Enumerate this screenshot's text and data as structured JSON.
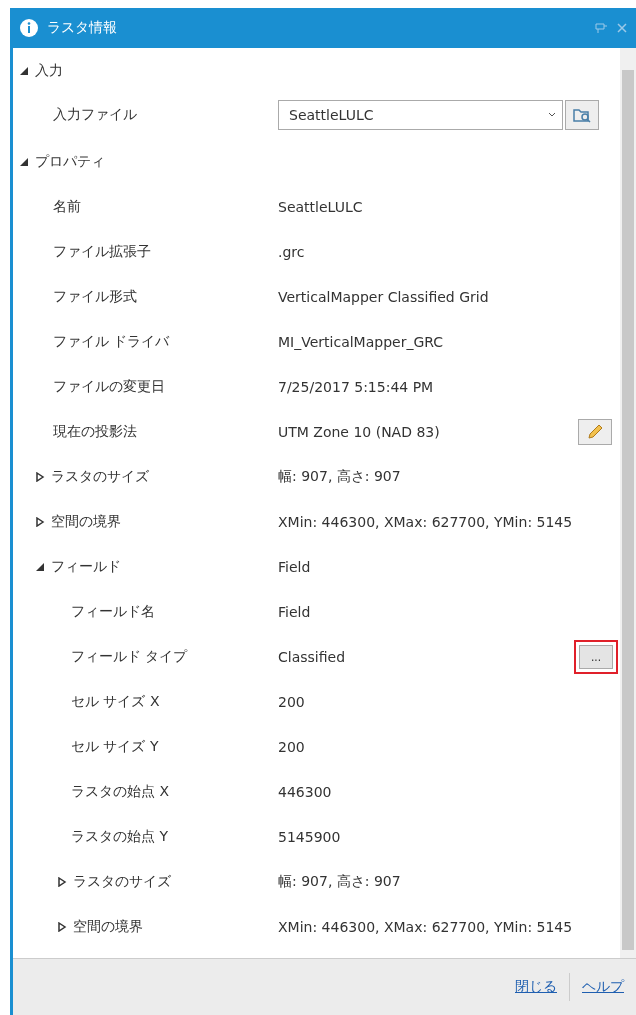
{
  "window": {
    "title": "ラスタ情報"
  },
  "sections": [
    {
      "label": "入力",
      "expanded": true,
      "children": [
        {
          "kind": "dropdown",
          "label": "入力ファイル",
          "value": "SeattleLULC"
        }
      ]
    },
    {
      "label": "プロパティ",
      "expanded": true,
      "children": [
        {
          "kind": "text",
          "label": "名前",
          "value": "SeattleLULC"
        },
        {
          "kind": "text",
          "label": "ファイル拡張子",
          "value": ".grc"
        },
        {
          "kind": "text",
          "label": "ファイル形式",
          "value": "VerticalMapper Classified Grid"
        },
        {
          "kind": "text",
          "label": "ファイル ドライバ",
          "value": "MI_VerticalMapper_GRC"
        },
        {
          "kind": "text",
          "label": "ファイルの変更日",
          "value": "7/25/2017 5:15:44 PM"
        },
        {
          "kind": "edit",
          "label": "現在の投影法",
          "value": "UTM Zone 10 (NAD 83)"
        },
        {
          "kind": "group",
          "label": "ラスタのサイズ",
          "value": "幅: 907, 高さ: 907",
          "expanded": false
        },
        {
          "kind": "group",
          "label": "空間の境界",
          "value": "XMin: 446300, XMax: 627700, YMin: 5145",
          "expanded": false
        },
        {
          "kind": "group",
          "label": "フィールド",
          "value": "Field",
          "expanded": true,
          "children": [
            {
              "kind": "text",
              "label": "フィールド名",
              "value": "Field"
            },
            {
              "kind": "more",
              "label": "フィールド タイプ",
              "value": "Classified",
              "button": "...",
              "highlighted": true
            },
            {
              "kind": "text",
              "label": "セル サイズ X",
              "value": "200"
            },
            {
              "kind": "text",
              "label": "セル サイズ Y",
              "value": "200"
            },
            {
              "kind": "text",
              "label": "ラスタの始点 X",
              "value": "446300"
            },
            {
              "kind": "text",
              "label": "ラスタの始点 Y",
              "value": "5145900"
            },
            {
              "kind": "group",
              "label": "ラスタのサイズ",
              "value": "幅: 907, 高さ: 907",
              "expanded": false
            },
            {
              "kind": "group",
              "label": "空間の境界",
              "value": "XMin: 446300, XMax: 627700, YMin: 5145",
              "expanded": false
            }
          ]
        }
      ]
    }
  ],
  "footer": {
    "links": [
      "閉じる",
      "ヘルプ"
    ]
  }
}
